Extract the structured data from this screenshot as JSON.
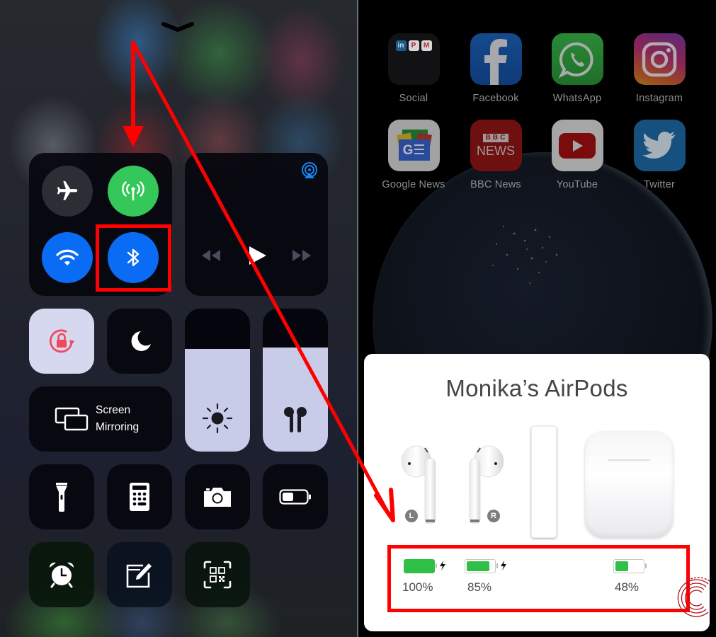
{
  "control_center": {
    "dismiss_chevron": "chevron-down",
    "connectivity": {
      "airplane_mode": {
        "icon": "airplane-icon",
        "state": "off",
        "color": "#2c2d33"
      },
      "cellular_data": {
        "icon": "antenna-icon",
        "state": "on",
        "color": "#34c759"
      },
      "wifi": {
        "icon": "wifi-icon",
        "state": "on",
        "color": "#0a6bf5"
      },
      "bluetooth": {
        "icon": "bluetooth-icon",
        "state": "on",
        "color": "#0a6bf5",
        "highlighted": true
      }
    },
    "media": {
      "airplay_icon": "airplay-audio-icon",
      "controls": [
        "rewind",
        "play",
        "fast-forward"
      ]
    },
    "orientation_lock": {
      "icon": "rotation-lock-icon",
      "state": "on",
      "accent": "#f0485a"
    },
    "do_not_disturb": {
      "icon": "moon-icon",
      "state": "off"
    },
    "screen_mirroring": {
      "line1": "Screen",
      "line2": "Mirroring"
    },
    "brightness": {
      "icon": "sun-icon",
      "level_percent": 72
    },
    "volume": {
      "icon": "airpods-icon",
      "level_percent": 73
    },
    "shortcuts_row1": [
      "flashlight",
      "calculator",
      "camera",
      "low-power-mode"
    ],
    "shortcuts_row2": [
      "alarm-clock",
      "notes",
      "qr-code-scanner"
    ]
  },
  "home_screen": {
    "apps": [
      {
        "label": "Social",
        "icon": "social-folder-icon",
        "folder_apps": [
          "in",
          "P",
          "M"
        ]
      },
      {
        "label": "Facebook",
        "icon": "facebook-icon"
      },
      {
        "label": "WhatsApp",
        "icon": "whatsapp-icon"
      },
      {
        "label": "Instagram",
        "icon": "instagram-icon"
      },
      {
        "label": "Google News",
        "icon": "google-news-icon",
        "glyph": "G☰"
      },
      {
        "label": "BBC News",
        "icon": "bbc-news-icon",
        "glyph_top": "BBC",
        "glyph_bottom": "NEWS"
      },
      {
        "label": "YouTube",
        "icon": "youtube-icon"
      },
      {
        "label": "Twitter",
        "icon": "twitter-icon"
      }
    ]
  },
  "airpods_card": {
    "title": "Monika’s AirPods",
    "left_badge": "L",
    "right_badge": "R",
    "batteries": [
      {
        "id": "left",
        "percent_label": "100%",
        "level": 1.0,
        "charging": true
      },
      {
        "id": "right",
        "percent_label": "85%",
        "level": 0.85,
        "charging": true
      },
      {
        "id": "case",
        "percent_label": "48%",
        "level": 0.48,
        "charging": false
      }
    ],
    "battery_color": "#30c048"
  },
  "annotations": {
    "highlight_color": "#ff0000"
  }
}
